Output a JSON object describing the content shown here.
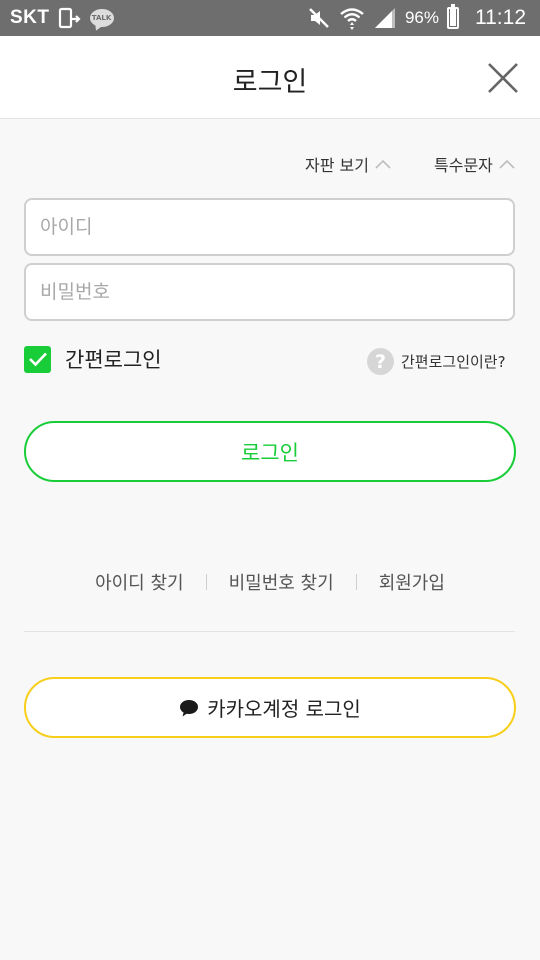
{
  "status_bar": {
    "carrier": "SKT",
    "talk_badge": "TALK",
    "battery_percent": "96%",
    "battery_level": 0.96,
    "time": "11:12",
    "icons": [
      "sim-icon",
      "talk-icon",
      "mute-icon",
      "wifi-icon",
      "signal-icon",
      "battery-icon"
    ]
  },
  "header": {
    "title": "로그인"
  },
  "options": {
    "keyboard_label": "자판 보기",
    "special_chars_label": "특수문자"
  },
  "form": {
    "id_placeholder": "아이디",
    "password_placeholder": "비밀번호",
    "id_value": "",
    "password_value": ""
  },
  "keep_login": {
    "label": "간편로그인",
    "checked": true,
    "help_label": "간편로그인이란?"
  },
  "login_button": {
    "label": "로그인"
  },
  "links": {
    "find_id": "아이디 찾기",
    "find_password": "비밀번호 찾기",
    "signup": "회원가입"
  },
  "kakao_button": {
    "label": "카카오계정 로그인"
  },
  "colors": {
    "status_bar": "#6e6e6e",
    "accent_green": "#19cd39",
    "kakao_yellow": "#f7cf1a",
    "background": "#f8f8f8"
  }
}
